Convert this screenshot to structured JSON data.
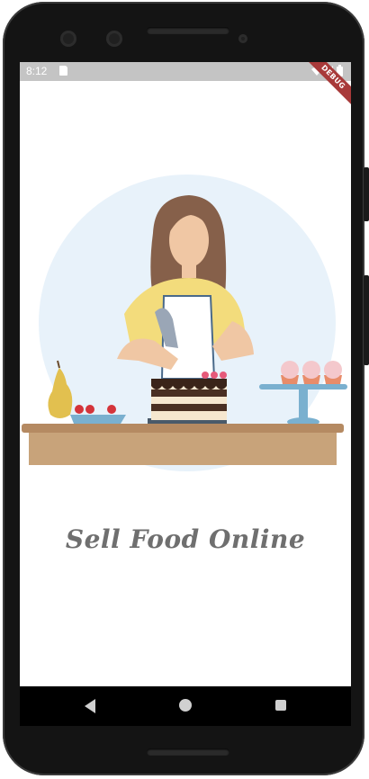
{
  "status_bar": {
    "time": "8:12",
    "debug_label": "DEBUG"
  },
  "main": {
    "title": "Sell Food Online"
  },
  "icons": [
    "sd-card-icon",
    "wifi-icon",
    "signal-icon",
    "battery-icon",
    "back-icon",
    "home-icon",
    "recents-icon"
  ],
  "colors": {
    "accent_title": "#6f6f6f",
    "circle": "#e8f2fa",
    "counter": "#c8a37a",
    "apron": "#f3dc7c"
  }
}
